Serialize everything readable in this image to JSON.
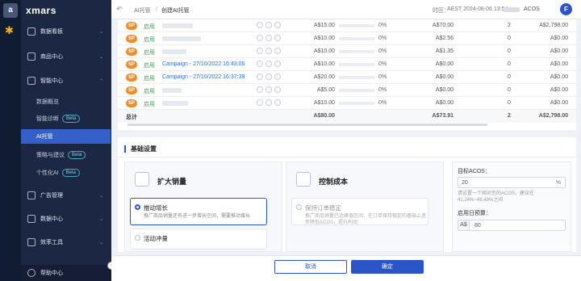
{
  "brand": {
    "logo": "xmars",
    "app_icon": "a"
  },
  "sidebar": {
    "groups": [
      {
        "label": "数据看板",
        "icon": "dashboard-icon"
      },
      {
        "label": "商品中心",
        "icon": "products-icon"
      },
      {
        "label": "智能中心",
        "icon": "smart-icon"
      },
      {
        "label": "广告管理",
        "icon": "ads-icon"
      },
      {
        "label": "数据中心",
        "icon": "data-icon"
      },
      {
        "label": "效率工具",
        "icon": "tools-icon"
      }
    ],
    "subitems": [
      {
        "label": "数据概览"
      },
      {
        "label": "智能诊断",
        "badge": "Beta"
      },
      {
        "label": "AI托管",
        "active": true
      },
      {
        "label": "策略与建议",
        "badge": "Beta"
      },
      {
        "label": "个性化AI",
        "badge": "Beta"
      }
    ],
    "help": "帮助中心"
  },
  "header": {
    "breadcrumb_parent": "AI托管",
    "breadcrumb_current": "创建AI托管",
    "timezone_label": "时区：",
    "timezone_value": "AEST 2024-08-06 13:54",
    "metric_select": "ACOS",
    "avatar": "F"
  },
  "table": {
    "rows": [
      {
        "type": "SP",
        "status": "启用",
        "name": "",
        "budget": "A$15.00",
        "pct": "0%",
        "spend": "A$70.00",
        "orders": "2",
        "sales": "A$2,798.00"
      },
      {
        "type": "SP",
        "status": "启用",
        "name": "",
        "budget": "A$10.00",
        "pct": "0%",
        "spend": "A$2.56",
        "orders": "0",
        "sales": "A$0.00"
      },
      {
        "type": "SP",
        "status": "启用",
        "name": "",
        "budget": "A$10.00",
        "pct": "0%",
        "spend": "A$1.35",
        "orders": "0",
        "sales": "A$0.00"
      },
      {
        "type": "SP",
        "status": "启用",
        "name": "Campaign - 27/10/2022 16:43:05",
        "budget": "A$10.00",
        "pct": "0%",
        "spend": "A$0.00",
        "orders": "0",
        "sales": "A$0.00"
      },
      {
        "type": "SP",
        "status": "启用",
        "name": "Campaign - 27/10/2022 16:37:39",
        "budget": "A$20.00",
        "pct": "0%",
        "spend": "A$0.00",
        "orders": "0",
        "sales": "A$0.00"
      },
      {
        "type": "SP",
        "status": "启用",
        "name": "",
        "budget": "A$5.00",
        "pct": "0%",
        "spend": "A$0.00",
        "orders": "0",
        "sales": "A$0.00"
      },
      {
        "type": "SP",
        "status": "启用",
        "name": "",
        "budget": "A$10.00",
        "pct": "0%",
        "spend": "A$0.00",
        "orders": "0",
        "sales": "A$0.00"
      }
    ],
    "total": {
      "label": "总计",
      "budget": "A$80.00",
      "spend": "A$73.91",
      "orders": "2",
      "sales": "A$2,798.00"
    }
  },
  "settings": {
    "title": "基础设置",
    "left_panel": {
      "title": "扩大销量",
      "options": [
        {
          "label": "推动增长",
          "desc": "推广商品销量还有进一步增长空间，需要推动增长",
          "selected": true
        },
        {
          "label": "活动冲量",
          "desc": "",
          "selected": false
        }
      ]
    },
    "mid_panel": {
      "title": "控制成本",
      "options": [
        {
          "label": "保持订单稳定",
          "desc": "推广商品销量已达峰值区间，在订单保持稳定的基础上逐步降低ACOS，提升利润",
          "selected": false
        }
      ]
    },
    "right_panel": {
      "acos_label": "目标ACOS：",
      "acos_value": "20",
      "acos_unit": "%",
      "acos_hint": "请设置一个相对您的ACOS，建议在41.24%~49.49%之间",
      "budget_label": "启用日预算：",
      "budget_prefix": "A$",
      "budget_value": "80"
    }
  },
  "footer": {
    "cancel": "取消",
    "confirm": "确定"
  }
}
